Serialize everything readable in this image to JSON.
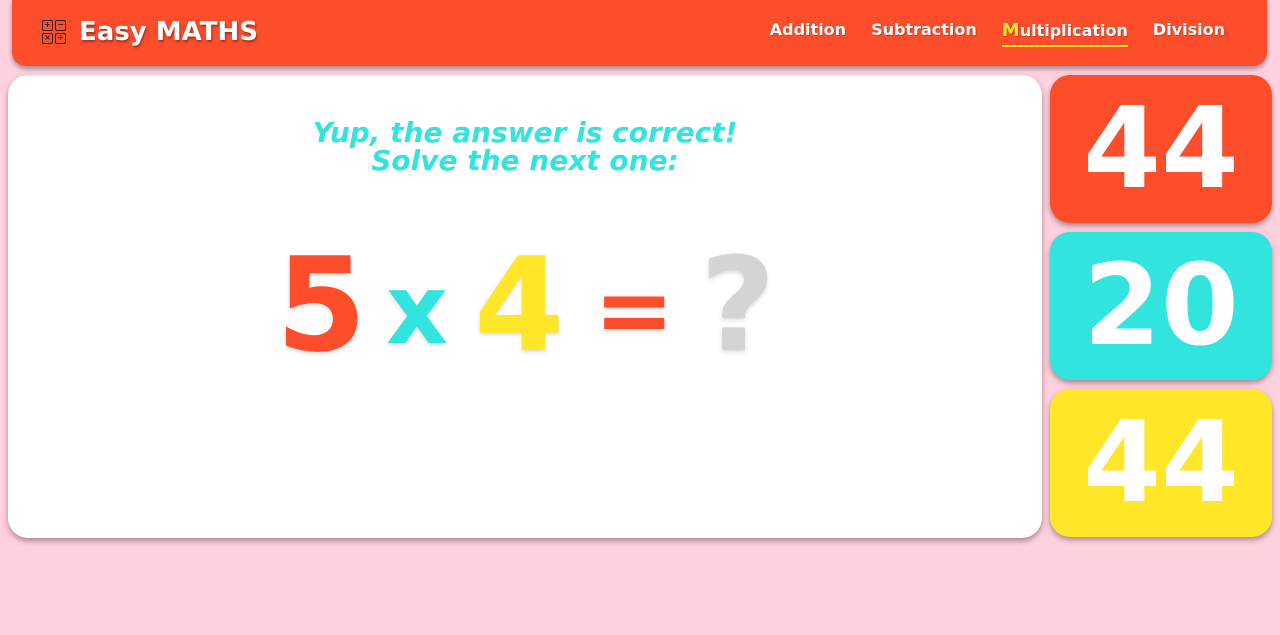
{
  "brand": {
    "title": "Easy MATHS",
    "icon": "calculator-icon",
    "icon_symbols": [
      "+",
      "−",
      "×",
      "÷"
    ]
  },
  "nav": {
    "items": [
      {
        "label": "Addition",
        "active": false
      },
      {
        "label": "Subtraction",
        "active": false
      },
      {
        "label": "Multiplication",
        "active": true,
        "label_first": "M",
        "label_rest": "ultiplication"
      },
      {
        "label": "Division",
        "active": false
      }
    ]
  },
  "message": {
    "line1": "Yup, the answer is correct!",
    "line2": "Solve the next one:"
  },
  "equation": {
    "operand_a": "5",
    "operator": "x",
    "operand_b": "4",
    "equals": "=",
    "unknown": "?"
  },
  "answers": [
    {
      "value": "44",
      "color": "#fd4d2b"
    },
    {
      "value": "20",
      "color": "#31e4de"
    },
    {
      "value": "44",
      "color": "#ffe629"
    }
  ],
  "colors": {
    "background": "#ffd0de",
    "primary": "#fd4d2b",
    "cyan": "#31e4de",
    "yellow": "#ffe629",
    "placeholder_gray": "#d4d4d4"
  }
}
